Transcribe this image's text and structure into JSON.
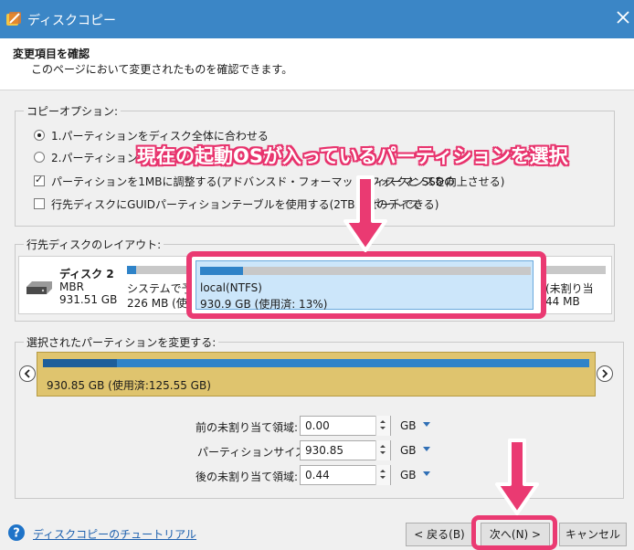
{
  "window": {
    "title": "ディスクコピー"
  },
  "header": {
    "title": "変更項目を確認",
    "subtitle": "このページにおいて変更されたものを確認できます。"
  },
  "copy_options": {
    "label": "コピーオプション:",
    "radio1": "1.パーティションをディスク全体に合わせる",
    "radio2": "2.パーティションをサ",
    "check1": "パーティションを1MBに調整する(アドバンスド・フォーマットディスクと SSDの",
    "check1_tail": "フォーマンスを向上させる)",
    "check2": "行先ディスクにGUIDパーティションテーブルを使用する(2TB以上のディス",
    "check2_tail": "ポートできる)"
  },
  "annotation": {
    "text": "現在の起動OSが入っているパーティションを選択",
    "color": "#ea3a72"
  },
  "layout_group": {
    "label": "行先ディスクのレイアウト:",
    "disk": {
      "name": "ディスク 2",
      "type": "MBR",
      "size": "931.51 GB"
    },
    "partitions": [
      {
        "name": "システムで予約",
        "size": "226 MB (使用済:",
        "fill": 0.15
      },
      {
        "name": "local(NTFS)",
        "size": "930.9 GB (使用済: 13%)",
        "fill": 0.13
      },
      {
        "name": "(未割り当",
        "size": "44 MB",
        "fill": 0
      }
    ]
  },
  "resize_group": {
    "label": "選択されたパーティションを変更する:",
    "bar_text": "930.85 GB (使用済:125.55 GB)",
    "bar_fill": 0.135,
    "fields": [
      {
        "label": "前の未割り当て領域:",
        "value": "0.00",
        "unit": "GB"
      },
      {
        "label": "パーティションサイズ:",
        "value": "930.85",
        "unit": "GB"
      },
      {
        "label": "後の未割り当て領域:",
        "value": "0.44",
        "unit": "GB"
      }
    ]
  },
  "footer": {
    "tutorial_link": "ディスクコピーのチュートリアル",
    "back": "< 戻る(B)",
    "next": "次へ(N) >",
    "cancel": "キャンセル"
  }
}
